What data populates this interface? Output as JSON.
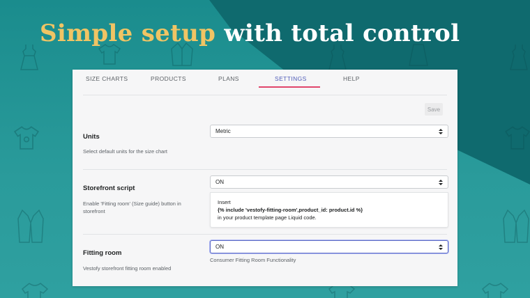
{
  "banner": {
    "headline_accent": "Simple setup",
    "headline_rest": "with total control",
    "colors": {
      "accent": "#f0c464",
      "background_light": "#2a9b9b",
      "background_dark": "#0f6a6e"
    },
    "decor_icons": [
      "dress-icon",
      "shirt-icon",
      "jacket-icon",
      "vest-icon",
      "skirt-icon",
      "coat-icon"
    ]
  },
  "tabs": [
    {
      "label": "SIZE CHARTS"
    },
    {
      "label": "PRODUCTS"
    },
    {
      "label": "PLANS"
    },
    {
      "label": "SETTINGS",
      "active": true
    },
    {
      "label": "HELP"
    }
  ],
  "save_label": "Save",
  "settings": {
    "units": {
      "title": "Units",
      "description": "Select default units for the size chart",
      "value": "Metric"
    },
    "storefront_script": {
      "title": "Storefront script",
      "description": "Enable 'Fitting room' (Size guide) button in storefront",
      "value": "ON",
      "info_line1": "Insert",
      "info_code": "{% include 'vestofy-fitting-room',product_id: product.id %}",
      "info_line3": "in your product template page Liquid code."
    },
    "fitting_room": {
      "title": "Fitting room",
      "description": "Vestofy storefront fitting room enabled",
      "value": "ON",
      "helper": "Consumer Fitting Room Functionality"
    }
  }
}
